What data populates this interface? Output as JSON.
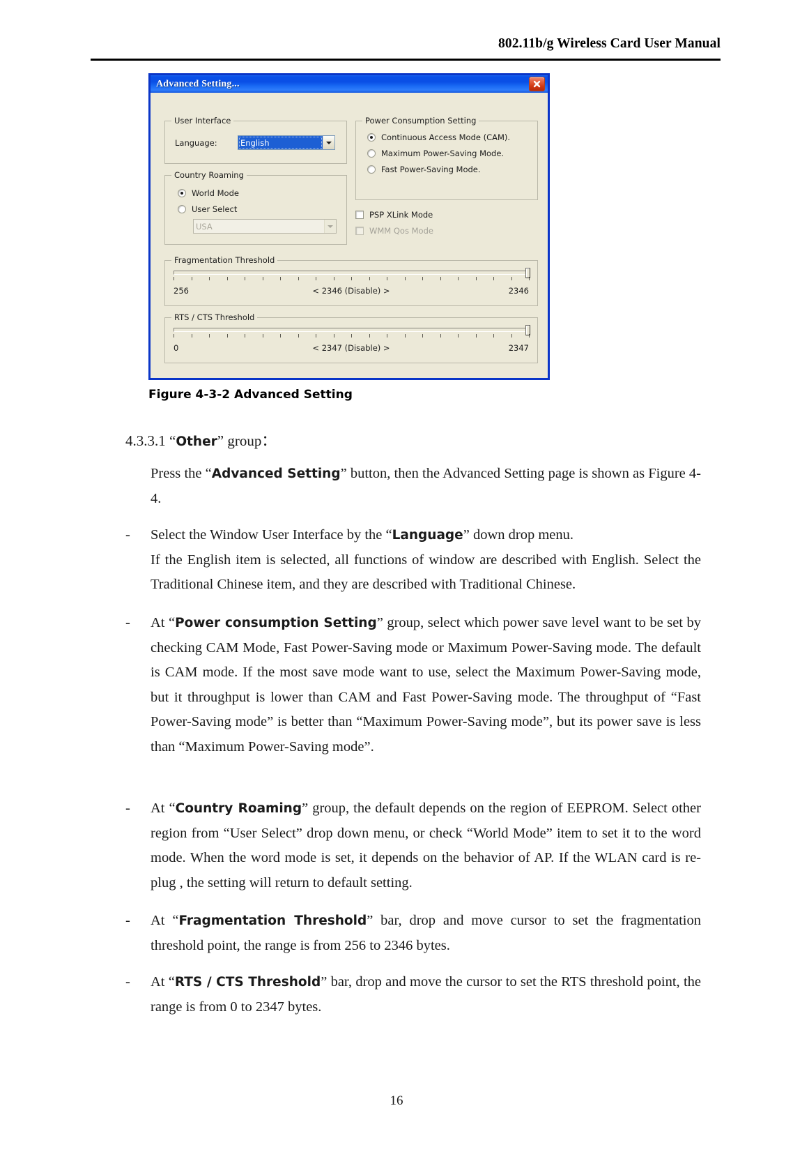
{
  "header": {
    "title": "802.11b/g Wireless Card User Manual"
  },
  "dialog": {
    "title": "Advanced Setting...",
    "close_icon": "close-icon",
    "groups": {
      "user_interface": {
        "legend": "User Interface",
        "language_label": "Language:",
        "language_value": "English"
      },
      "country_roaming": {
        "legend": "Country Roaming",
        "options": [
          {
            "label": "World Mode",
            "selected": true
          },
          {
            "label": "User Select",
            "selected": false
          }
        ],
        "region_value": "USA"
      },
      "power_consumption": {
        "legend": "Power Consumption Setting",
        "options": [
          {
            "label": "Continuous Access Mode (CAM).",
            "selected": true
          },
          {
            "label": "Maximum Power-Saving Mode.",
            "selected": false
          },
          {
            "label": "Fast Power-Saving Mode.",
            "selected": false
          }
        ]
      },
      "extra_checks": [
        {
          "label": "PSP XLink Mode",
          "checked": false,
          "disabled": false
        },
        {
          "label": "WMM Qos Mode",
          "checked": false,
          "disabled": true
        }
      ],
      "fragmentation_threshold": {
        "legend": "Fragmentation Threshold",
        "min_label": "256",
        "current_label": "< 2346 (Disable) >",
        "max_label": "2346"
      },
      "rts_cts_threshold": {
        "legend": "RTS / CTS Threshold",
        "min_label": "0",
        "current_label": "< 2347 (Disable) >",
        "max_label": "2347"
      }
    },
    "colors": {
      "titlebar_blue": "#0a4fe6",
      "border_blue": "#0a35c8",
      "face": "#ece9d8",
      "selection_blue": "#1d5fd4",
      "close_red": "#cf3611"
    }
  },
  "figure": {
    "caption": "Figure 4-3-2 Advanced Setting"
  },
  "body": {
    "section_number": "4.3.3.1 ",
    "section_term": "Other",
    "section_tail": "” group：",
    "section_quote_open": "“",
    "press": {
      "pre": "Press the “",
      "term": "Advanced Setting",
      "post": "” button, then the Advanced Setting page is shown as Figure 4-4."
    },
    "bullets": [
      {
        "dash": "-",
        "pre": "Select the Window User Interface by the “",
        "term": "Language",
        "post": "” down drop menu.",
        "extra": "If the English item is selected, all functions of window are described with English. Select the Traditional Chinese item, and they are described with Traditional Chinese."
      },
      {
        "dash": "-",
        "pre": "At “",
        "term": "Power consumption Setting",
        "post": "” group, select which power save level want to be set by checking CAM Mode, Fast Power-Saving mode or Maximum Power-Saving mode. The default is CAM mode. If the most save mode want to use, select the Maximum Power-Saving mode, but it throughput is lower than CAM and Fast Power-Saving mode. The throughput of  “Fast Power-Saving mode” is better than “Maximum Power-Saving mode”, but its power save is less than “Maximum Power-Saving mode”.",
        "extra": ""
      },
      {
        "dash": "-",
        "pre": "At “",
        "term": "Country Roaming",
        "post": "” group, the default depends on the region of EEPROM. Select other region from “User Select” drop down menu, or check “World Mode” item to set it to the word mode. When the word mode is set, it depends on the behavior of AP. If the WLAN card is re-plug , the setting will return to default setting.",
        "extra": ""
      },
      {
        "dash": "-",
        "pre": "At “",
        "term": "Fragmentation Threshold",
        "post": "” bar, drop and move cursor to set the fragmentation threshold point, the range is from 256 to 2346 bytes.",
        "extra": ""
      },
      {
        "dash": "-",
        "pre": "At “",
        "term": "RTS / CTS Threshold",
        "post": "” bar, drop and move the cursor to set the RTS threshold point, the range is from 0 to 2347 bytes.",
        "extra": ""
      }
    ]
  },
  "footer": {
    "page_number": "16"
  }
}
